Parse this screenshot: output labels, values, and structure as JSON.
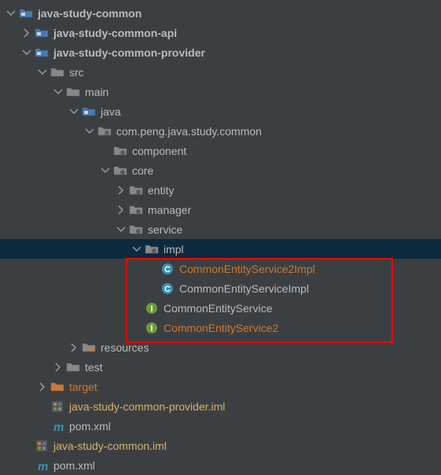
{
  "tree": {
    "root": {
      "label": "java-study-common"
    },
    "api": {
      "label": "java-study-common-api"
    },
    "provider": {
      "label": "java-study-common-provider"
    },
    "src": {
      "label": "src"
    },
    "main": {
      "label": "main"
    },
    "java": {
      "label": "java"
    },
    "pkg": {
      "label": "com.peng.java.study.common"
    },
    "component": {
      "label": "component"
    },
    "core": {
      "label": "core"
    },
    "entity": {
      "label": "entity"
    },
    "manager": {
      "label": "manager"
    },
    "service": {
      "label": "service"
    },
    "impl": {
      "label": "impl"
    },
    "cls1": {
      "label": "CommonEntityService2Impl"
    },
    "cls2": {
      "label": "CommonEntityServiceImpl"
    },
    "if1": {
      "label": "CommonEntityService"
    },
    "if2": {
      "label": "CommonEntityService2"
    },
    "resources": {
      "label": "resources"
    },
    "test": {
      "label": "test"
    },
    "target": {
      "label": "target"
    },
    "provider_iml": {
      "label": "java-study-common-provider.iml"
    },
    "provider_pom": {
      "label": "pom.xml"
    },
    "root_iml": {
      "label": "java-study-common.iml"
    },
    "root_pom": {
      "label": "pom.xml"
    }
  }
}
